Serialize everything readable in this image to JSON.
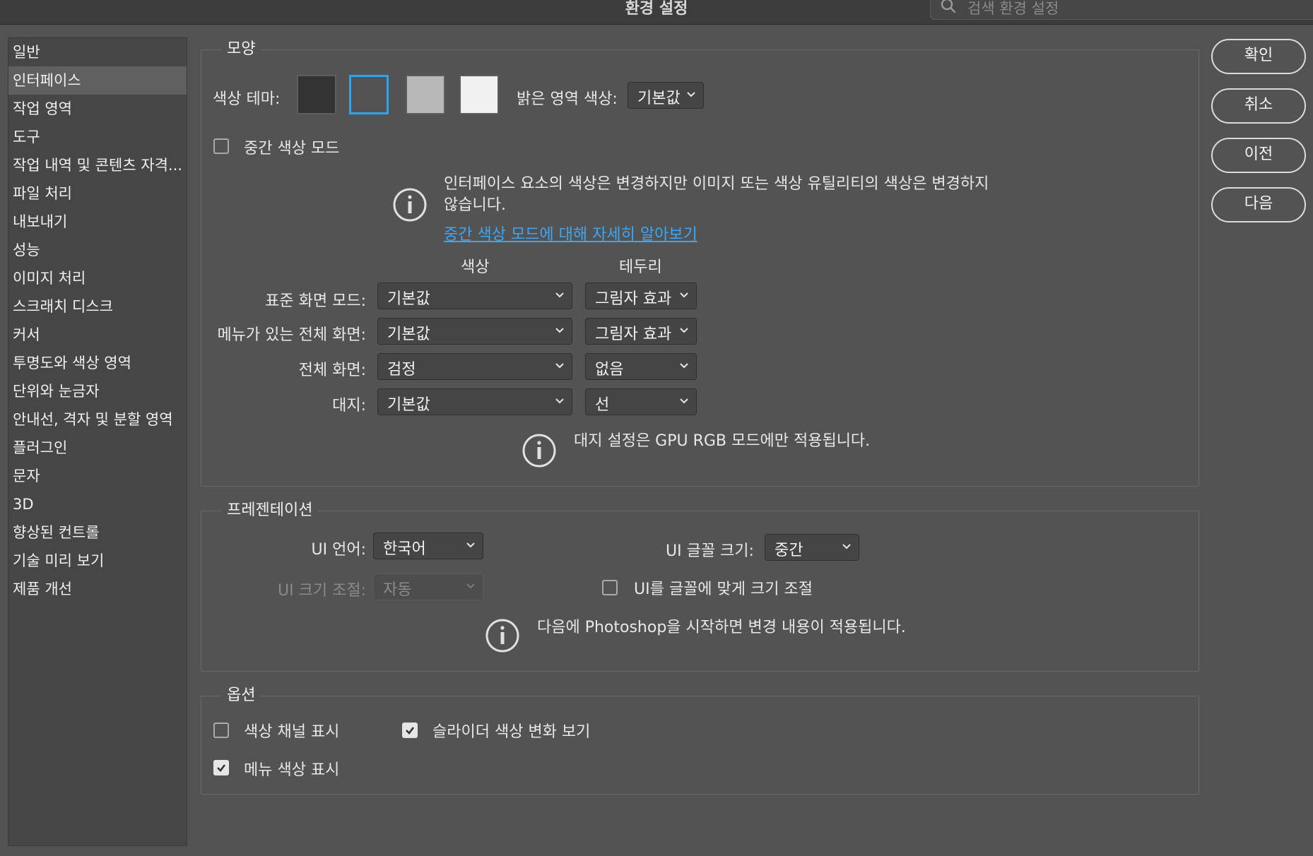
{
  "window": {
    "title": "환경 설정"
  },
  "search": {
    "placeholder": "검색 환경 설정"
  },
  "sidebar": {
    "items": [
      {
        "label": "일반"
      },
      {
        "label": "인터페이스",
        "active": true
      },
      {
        "label": "작업 영역"
      },
      {
        "label": "도구"
      },
      {
        "label": "작업 내역 및 콘텐츠 자격..."
      },
      {
        "label": "파일 처리"
      },
      {
        "label": "내보내기"
      },
      {
        "label": "성능"
      },
      {
        "label": "이미지 처리"
      },
      {
        "label": "스크래치 디스크"
      },
      {
        "label": "커서"
      },
      {
        "label": "투명도와 색상 영역"
      },
      {
        "label": "단위와 눈금자"
      },
      {
        "label": "안내선, 격자 및 분할 영역"
      },
      {
        "label": "플러그인"
      },
      {
        "label": "문자"
      },
      {
        "label": "3D"
      },
      {
        "label": "향상된 컨트롤"
      },
      {
        "label": "기술 미리 보기"
      },
      {
        "label": "제품 개선"
      }
    ]
  },
  "appearance": {
    "legend": "모양",
    "color_theme_label": "색상 테마:",
    "theme_swatches": [
      "#323232",
      "#535353",
      "#b8b8b8",
      "#f0f0f0"
    ],
    "selected_theme_index": 1,
    "highlight_color_label": "밝은 영역 색상:",
    "highlight_color_value": "기본값",
    "mid_color_mode_label": "중간 색상 모드",
    "mid_color_mode_checked": false,
    "info_line1": "인터페이스 요소의 색상은 변경하지만 이미지 또는 색상 유틸리티의 색상은 변경하지",
    "info_line2": "않습니다.",
    "info_link": "중간 색상 모드에 대해 자세히 알아보기",
    "col_color": "색상",
    "col_border": "테두리",
    "rows": [
      {
        "label": "표준 화면 모드:",
        "color": "기본값",
        "border": "그림자 효과"
      },
      {
        "label": "메뉴가 있는 전체 화면:",
        "color": "기본값",
        "border": "그림자 효과"
      },
      {
        "label": "전체 화면:",
        "color": "검정",
        "border": "없음"
      },
      {
        "label": "대지:",
        "color": "기본값",
        "border": "선"
      }
    ],
    "artboard_info": "대지 설정은 GPU RGB 모드에만 적용됩니다."
  },
  "presentation": {
    "legend": "프레젠테이션",
    "ui_language_label": "UI 언어:",
    "ui_language_value": "한국어",
    "ui_font_size_label": "UI 글꼴 크기:",
    "ui_font_size_value": "중간",
    "ui_scaling_label": "UI 크기 조절:",
    "ui_scaling_value": "자동",
    "scale_to_font_label": "UI를 글꼴에 맞게 크기 조절",
    "scale_to_font_checked": false,
    "restart_info": "다음에 Photoshop을 시작하면 변경 내용이 적용됩니다."
  },
  "options": {
    "legend": "옵션",
    "show_channels_label": "색상 채널 표시",
    "show_channels_checked": false,
    "slider_preview_label": "슬라이더 색상 변화 보기",
    "slider_preview_checked": true,
    "menu_colors_label": "메뉴 색상 표시",
    "menu_colors_checked": true
  },
  "buttons": {
    "ok": "확인",
    "cancel": "취소",
    "prev": "이전",
    "next": "다음"
  },
  "colors": {
    "background": "#535353",
    "accent_blue": "#2da4ee",
    "link_blue": "#3ea6f4"
  }
}
